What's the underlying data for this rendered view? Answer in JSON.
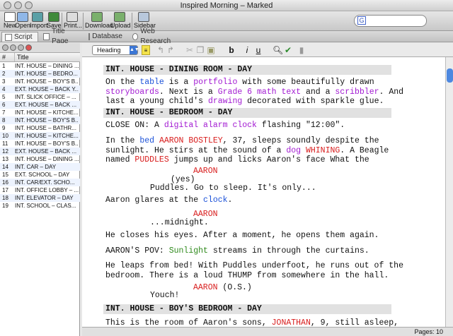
{
  "window": {
    "title": "Inspired Morning – Marked"
  },
  "toolbar": {
    "new": "New",
    "open": "Open",
    "import": "Import",
    "save": "Save",
    "print": "Print...",
    "download": "Download",
    "upload": "Upload",
    "sidebar": "Sidebar"
  },
  "search": {
    "icon_letter": "G",
    "value": ""
  },
  "tabs": {
    "script": "Script",
    "title_page": "Title Page",
    "database": "Database",
    "web_research": "Web Research"
  },
  "scene_list": {
    "col_num": "#",
    "col_title": "Title",
    "rows": [
      {
        "n": "1",
        "t": "INT. HOUSE – DINING ..."
      },
      {
        "n": "2",
        "t": "INT. HOUSE – BEDRO..."
      },
      {
        "n": "3",
        "t": "INT. HOUSE – BOY'S B..."
      },
      {
        "n": "4",
        "t": "EXT. HOUSE – BACK Y..."
      },
      {
        "n": "5",
        "t": "INT. SLICK OFFICE – ..."
      },
      {
        "n": "6",
        "t": "EXT. HOUSE – BACK ..."
      },
      {
        "n": "7",
        "t": "INT. HOUSE – KITCHE..."
      },
      {
        "n": "8",
        "t": "INT. HOUSE – BOY'S B..."
      },
      {
        "n": "9",
        "t": "INT. HOUSE – BATHR..."
      },
      {
        "n": "10",
        "t": "INT. HOUSE – KITCHE..."
      },
      {
        "n": "11",
        "t": "INT. HOUSE – BOY'S B..."
      },
      {
        "n": "12",
        "t": "EXT. HOUSE – BACK ..."
      },
      {
        "n": "13",
        "t": "INT. HOUSE – DINING ..."
      },
      {
        "n": "14",
        "t": "INT. CAR – DAY"
      },
      {
        "n": "15",
        "t": "EXT. SCHOOL – DAY"
      },
      {
        "n": "16",
        "t": "INT. CAR/EXT. SCHO..."
      },
      {
        "n": "17",
        "t": "INT. OFFICE LOBBY – ..."
      },
      {
        "n": "18",
        "t": "INT. ELEVATOR – DAY"
      },
      {
        "n": "19",
        "t": "INT. SCHOOL – CLAS..."
      }
    ]
  },
  "editor_toolbar": {
    "element_type": "Heading"
  },
  "script": {
    "h1": "INT. HOUSE - DINING ROOM - DAY",
    "a1": {
      "p1": "On the ",
      "table": "table",
      "p2": " is a ",
      "portfolio": "portfolio",
      "p3": " with some beautifully drawn",
      "storyboards": "storyboards",
      "p4": ". Next is a ",
      "grade": "Grade 6 math text",
      "p5": " and a ",
      "scribbler": "scribbler",
      "p6": ". And",
      "p7": "last a young child's ",
      "drawing": "drawing",
      "p8": " decorated with sparkle glue."
    },
    "h2": "INT. HOUSE - BEDROOM - DAY",
    "a2": {
      "p1": "CLOSE ON: A ",
      "clock": "digital alarm clock",
      "p2": " flashing \"12:00\"."
    },
    "a3": {
      "p1": "In the ",
      "bed": "bed",
      "sp": " ",
      "aaron": "AARON BOSTLEY",
      "p2": ", 37, sleeps soundly despite the",
      "p3": "sunlight. He stirs at the sound of a ",
      "dog": "dog",
      "sp2": " ",
      "whining": "WHINING",
      "p4": ". A Beagle",
      "p5": "named ",
      "puddles": "PUDDLES",
      "p6": " jumps up and licks Aaron's face What the"
    },
    "c1": "AARON",
    "par1": "(yes)",
    "d1": "Puddles. Go to sleep. It's only...",
    "a4": {
      "p1": "Aaron glares at the ",
      "clock": "clock",
      "p2": "."
    },
    "c2": "AARON",
    "d2": "...midnight.",
    "a5": "He closes his eyes. After a moment, he opens them again.",
    "a6": {
      "p1": "AARON'S POV: ",
      "sunlight": "Sunlight",
      "p2": " streams in through the curtains."
    },
    "a7": {
      "l1": "He leaps from bed! With Puddles underfoot, he runs out of the",
      "l2": "bedroom. There is a loud THUMP from somewhere in the hall."
    },
    "c3": "AARON",
    "c3ext": " (O.S.)",
    "d3": "Youch!",
    "h3": "INT. HOUSE - BOY'S BEDROOM - DAY",
    "a8": {
      "p1": "This is the room of Aaron's sons, ",
      "jonathan": "JONATHAN",
      "p2": ", 9, still asleep,"
    }
  },
  "status": {
    "pages": "Pages: 10"
  }
}
